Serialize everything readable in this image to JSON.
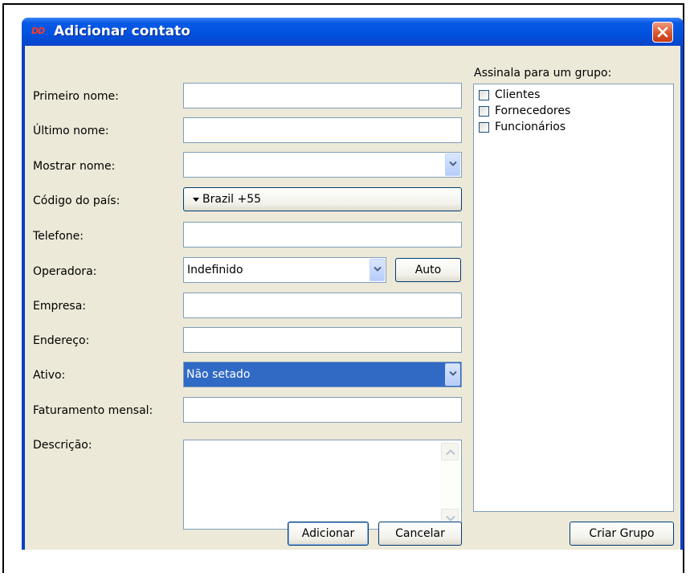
{
  "window": {
    "title": "Adicionar contato",
    "logo_text": "DD"
  },
  "form": {
    "first_name_label": "Primeiro nome:",
    "first_name_value": "",
    "last_name_label": "Último nome:",
    "last_name_value": "",
    "display_name_label": "Mostrar nome:",
    "display_name_value": "",
    "country_code_label": "Código do país:",
    "country_code_value": "Brazil +55",
    "phone_label": "Telefone:",
    "phone_value": "",
    "carrier_label": "Operadora:",
    "carrier_value": "Indefinido",
    "carrier_auto_button": "Auto",
    "company_label": "Empresa:",
    "company_value": "",
    "address_label": "Endereço:",
    "address_value": "",
    "active_label": "Ativo:",
    "active_value": "Não setado",
    "monthly_billing_label": "Faturamento mensal:",
    "monthly_billing_value": "",
    "description_label": "Descrição:",
    "description_value": ""
  },
  "groups": {
    "title": "Assinala para um grupo:",
    "items": [
      {
        "label": "Clientes",
        "checked": false
      },
      {
        "label": "Fornecedores",
        "checked": false
      },
      {
        "label": "Funcionários",
        "checked": false
      }
    ]
  },
  "buttons": {
    "add": "Adicionar",
    "cancel": "Cancelar",
    "create_group": "Criar Grupo"
  },
  "icons": {
    "close": "close-icon",
    "dropdown": "chevron-down-icon",
    "scroll_up": "arrow-up-icon",
    "scroll_down": "arrow-down-icon"
  },
  "colors": {
    "titlebar": "#0052e0",
    "selection": "#316ac5",
    "dialog_bg": "#ece9d8",
    "close_button": "#d9562e"
  }
}
